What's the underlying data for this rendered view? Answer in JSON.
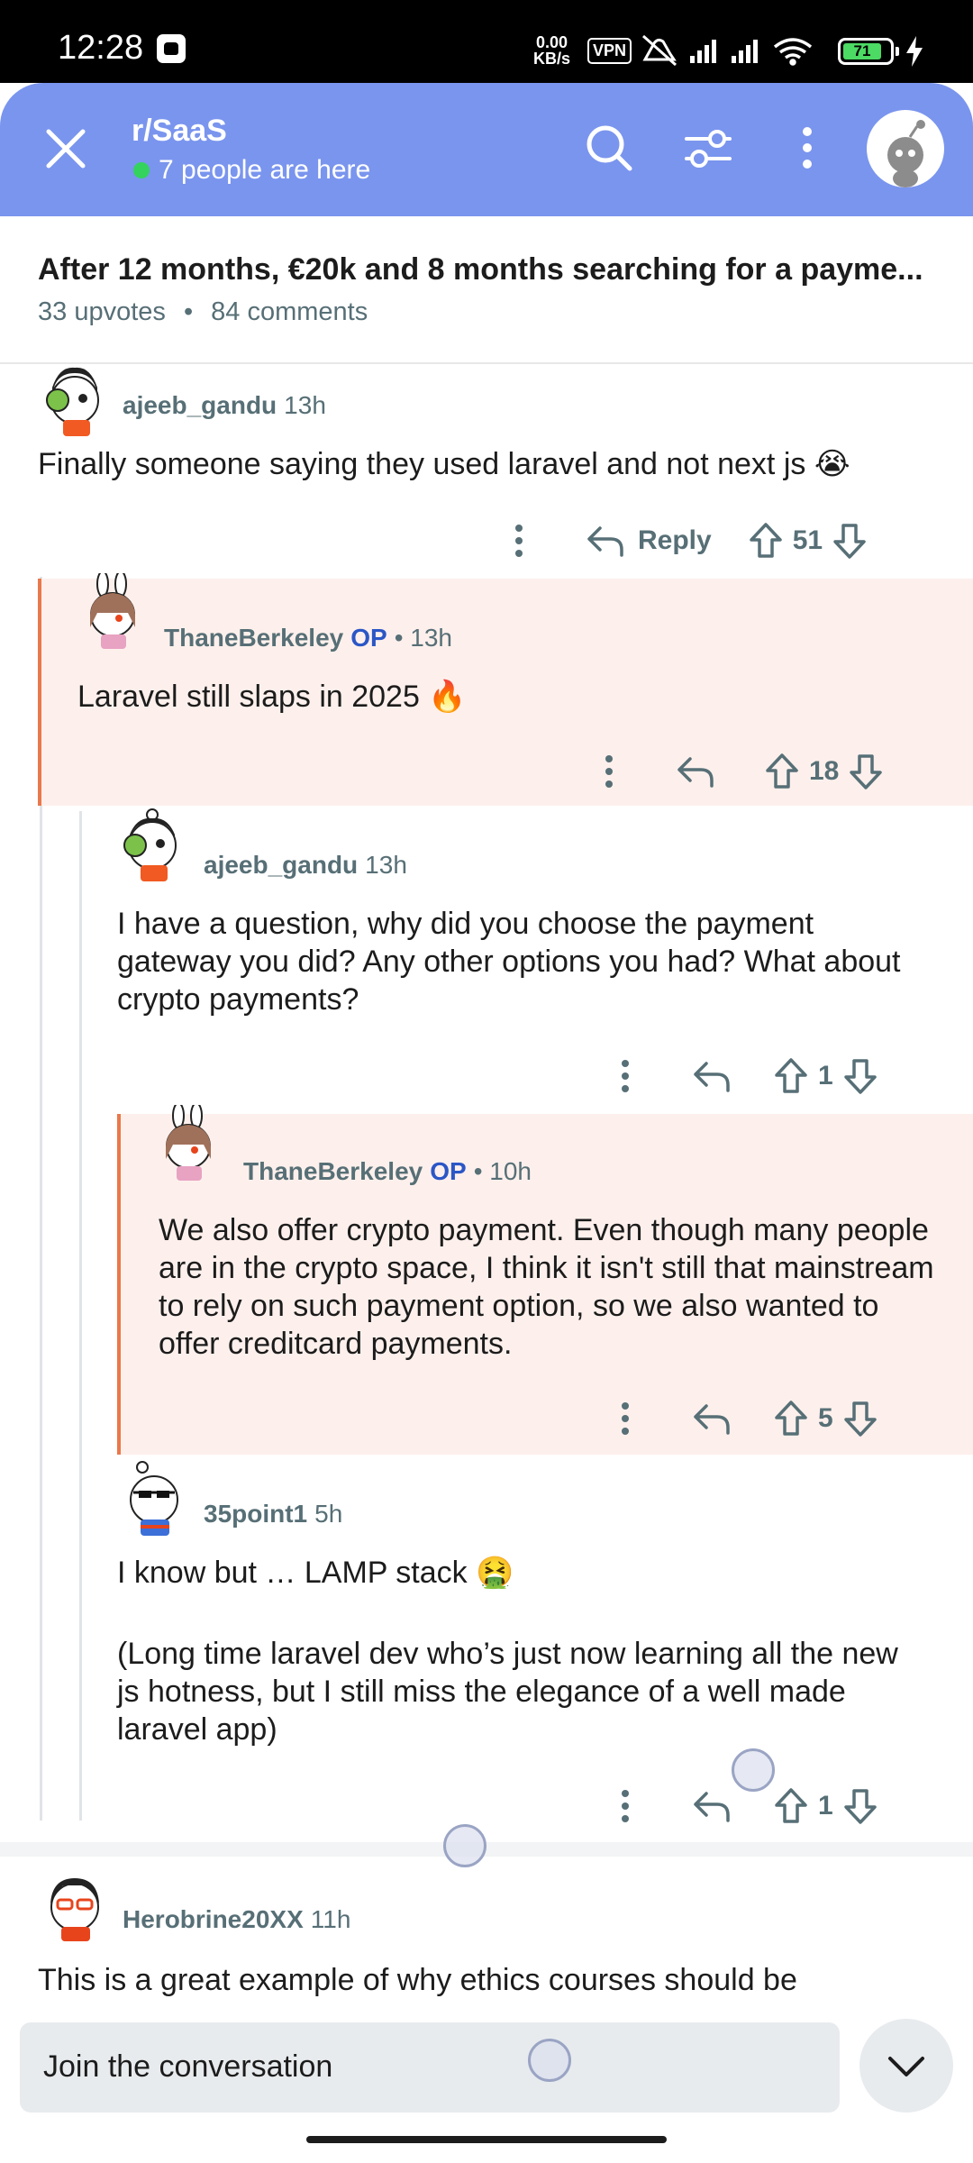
{
  "status_bar": {
    "time": "12:28",
    "net_speed_value": "0.00",
    "net_speed_unit": "KB/s",
    "vpn": "VPN",
    "battery": "71"
  },
  "header": {
    "subreddit": "r/SaaS",
    "presence": "7 people are here"
  },
  "post": {
    "title": "After 12 months, €20k and 8 months searching for a payme...",
    "upvotes": "33 upvotes",
    "separator": "•",
    "comments": "84 comments"
  },
  "comments": [
    {
      "author": "ajeeb_gandu",
      "op": "",
      "time": "13h",
      "body": "Finally someone saying they used laravel and not next js 😭",
      "reply_label": "Reply",
      "score": "51"
    },
    {
      "author": "ThaneBerkeley",
      "op": "OP",
      "time": "• 13h",
      "body": "Laravel still slaps in 2025 🔥",
      "score": "18"
    },
    {
      "author": "ajeeb_gandu",
      "op": "",
      "time": "13h",
      "body": "I have a question, why did you choose the payment gateway you did? Any other options you had? What about crypto payments?",
      "score": "1"
    },
    {
      "author": "ThaneBerkeley",
      "op": "OP",
      "time": "• 10h",
      "body": "We also offer crypto payment. Even though many people are in the crypto space, I think it isn't still that mainstream to rely on such payment option, so we also wanted to offer creditcard payments.",
      "score": "5"
    },
    {
      "author": "35point1",
      "op": "",
      "time": "5h",
      "body_line1": "I know but … LAMP stack 🤮",
      "body_line2": "(Long time laravel dev who’s just now learning all the new js hotness, but I still miss the elegance of a well made laravel app)",
      "score": "1"
    },
    {
      "author": "Herobrine20XX",
      "op": "",
      "time": "11h",
      "body": "This is a great example of why ethics courses should be"
    }
  ],
  "composer": {
    "placeholder": "Join the conversation"
  },
  "colors": {
    "header_bg": "#7a95ee",
    "op_bg": "#fdf0ec",
    "op_border": "#e9784b",
    "op_label": "#2b56c6",
    "online_dot": "#33d35d"
  }
}
